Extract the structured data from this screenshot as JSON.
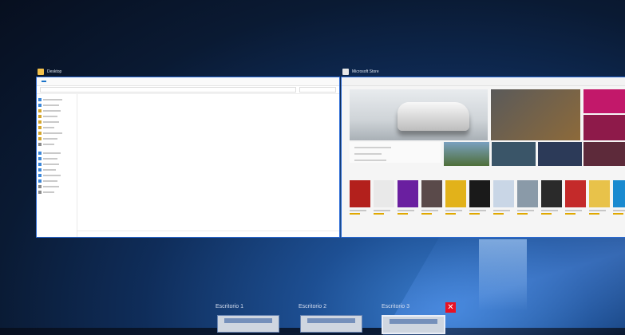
{
  "windows": [
    {
      "title": "Desktop",
      "icon": "folder-icon"
    },
    {
      "title": "Microsoft Store",
      "icon": "store-icon"
    }
  ],
  "desktops": {
    "items": [
      {
        "label": "Escritorio 1"
      },
      {
        "label": "Escritorio 2"
      },
      {
        "label": "Escritorio 3"
      }
    ],
    "close_glyph": "✕"
  },
  "accent": "#2b6bd6"
}
